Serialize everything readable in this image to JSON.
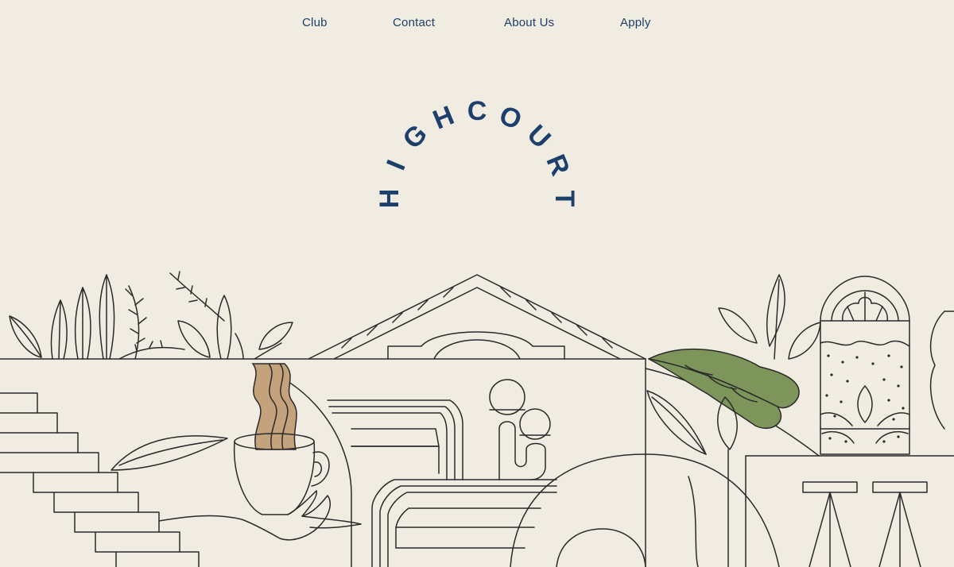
{
  "nav": {
    "items": [
      {
        "label": "Club"
      },
      {
        "label": "Contact"
      },
      {
        "label": "About Us"
      },
      {
        "label": "Apply"
      }
    ]
  },
  "brand": {
    "wordmark": "HIGHCOURT",
    "color": "#1c3f6b"
  },
  "theme": {
    "background": "#f1ece1",
    "line": "#2a2a2a",
    "steam": "#c4a27b",
    "leaf": "#7d955a"
  },
  "illustration": {
    "icons": [
      "plant-icon",
      "fern-icon",
      "temple-icon",
      "coffee-cup-icon",
      "hand-icon",
      "arched-window-icon",
      "leaf-icon",
      "bar-stool-icon",
      "staircase-icon",
      "sofa-icon"
    ]
  }
}
